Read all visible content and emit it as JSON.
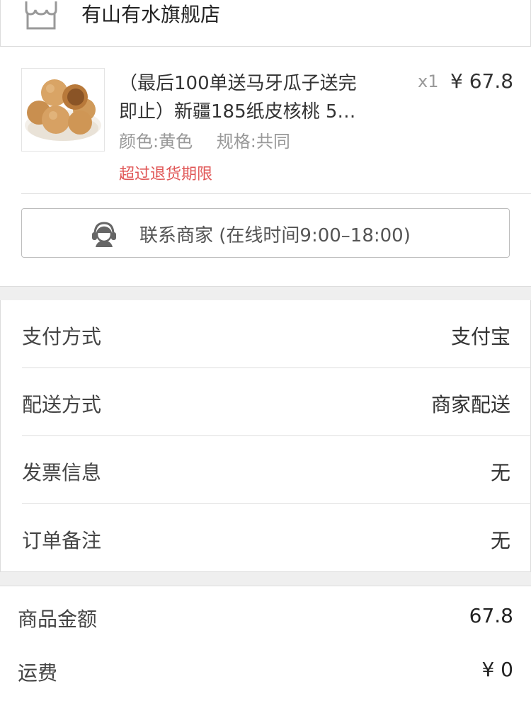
{
  "store": {
    "name": "有山有水旗舰店",
    "icon": "store-icon"
  },
  "product": {
    "title_line1": "（最后100单送马牙瓜子送完",
    "title_line2": "即止）新疆185纸皮核桃 5…",
    "quantity": "x1",
    "price": "¥ 67.8",
    "color": "颜色:黄色",
    "spec": "规格:共同",
    "return_note": "超过退货期限",
    "image": "walnut-product-image"
  },
  "contact": {
    "label": "联系商家 (在线时间9:00–18:00)",
    "icon": "customer-service-icon"
  },
  "info": {
    "payment": {
      "label": "支付方式",
      "value": "支付宝"
    },
    "delivery": {
      "label": "配送方式",
      "value": "商家配送"
    },
    "invoice": {
      "label": "发票信息",
      "value": "无"
    },
    "remark": {
      "label": "订单备注",
      "value": "无"
    }
  },
  "totals": {
    "goods": {
      "label": "商品金额",
      "value": "67.8"
    },
    "shipping": {
      "label": "运费",
      "value": "¥ 0"
    }
  },
  "colors": {
    "warning": "#e05656",
    "muted": "#999999",
    "separator": "#efefef"
  }
}
